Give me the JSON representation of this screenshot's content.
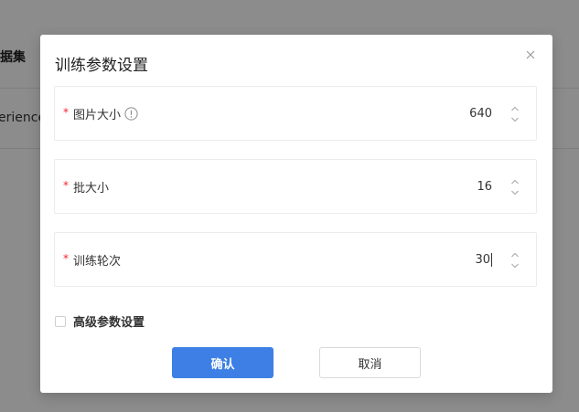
{
  "background": {
    "header_text": "据集",
    "row_text": "erience"
  },
  "modal": {
    "title": "训练参数设置",
    "close_icon": "close-icon",
    "fields": [
      {
        "label": "图片大小",
        "value": "640",
        "required": "*",
        "has_info": true
      },
      {
        "label": "批大小",
        "value": "16",
        "required": "*"
      },
      {
        "label": "训练轮次",
        "value": "30",
        "required": "*"
      }
    ],
    "advanced_label": "高级参数设置",
    "confirm_label": "确认",
    "cancel_label": "取消"
  },
  "colors": {
    "primary": "#3d7fe4",
    "required": "#f5222d",
    "overlay": "rgba(0,0,0,0.45)"
  }
}
